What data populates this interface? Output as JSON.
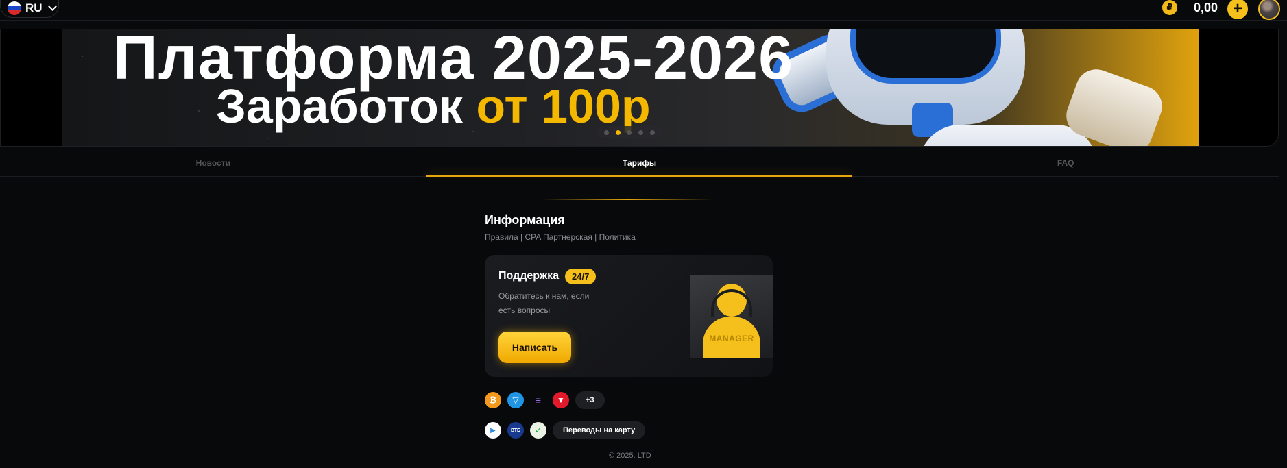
{
  "header": {
    "language": "RU",
    "currency_symbol": "₽",
    "balance": "0,00",
    "add_label": "+"
  },
  "banner": {
    "line1": "Платформа 2025-2026",
    "line2_prefix": "Заработок",
    "line2_highlight": "от 100р",
    "slides_total": 5,
    "active_slide": 2
  },
  "tabs": [
    {
      "label": "Новости",
      "active": false
    },
    {
      "label": "Тарифы",
      "active": true
    },
    {
      "label": "FAQ",
      "active": false
    }
  ],
  "info": {
    "title": "Информация",
    "links": "Правила | CPA Партнерская | Политика"
  },
  "support": {
    "title": "Поддержка",
    "badge": "24/7",
    "description": "Обратитесь к нам, если есть вопросы",
    "button": "Написать",
    "image_label": "MANAGER"
  },
  "payments": {
    "crypto": [
      "bitcoin-icon",
      "ton-icon",
      "solana-icon",
      "tron-icon"
    ],
    "crypto_glyphs": [
      "₿",
      "▽",
      "≡",
      "▼"
    ],
    "crypto_more": "+3",
    "banks": [
      "google-pay-icon",
      "vtb-icon",
      "sber-icon"
    ],
    "bank_glyphs": [
      "▶",
      "ВТБ",
      "✓"
    ],
    "card_transfer": "Переводы на карту"
  },
  "footer": {
    "copyright": "© 2025. LTD"
  },
  "colors": {
    "accent": "#f5c01b",
    "background": "#08090b"
  }
}
